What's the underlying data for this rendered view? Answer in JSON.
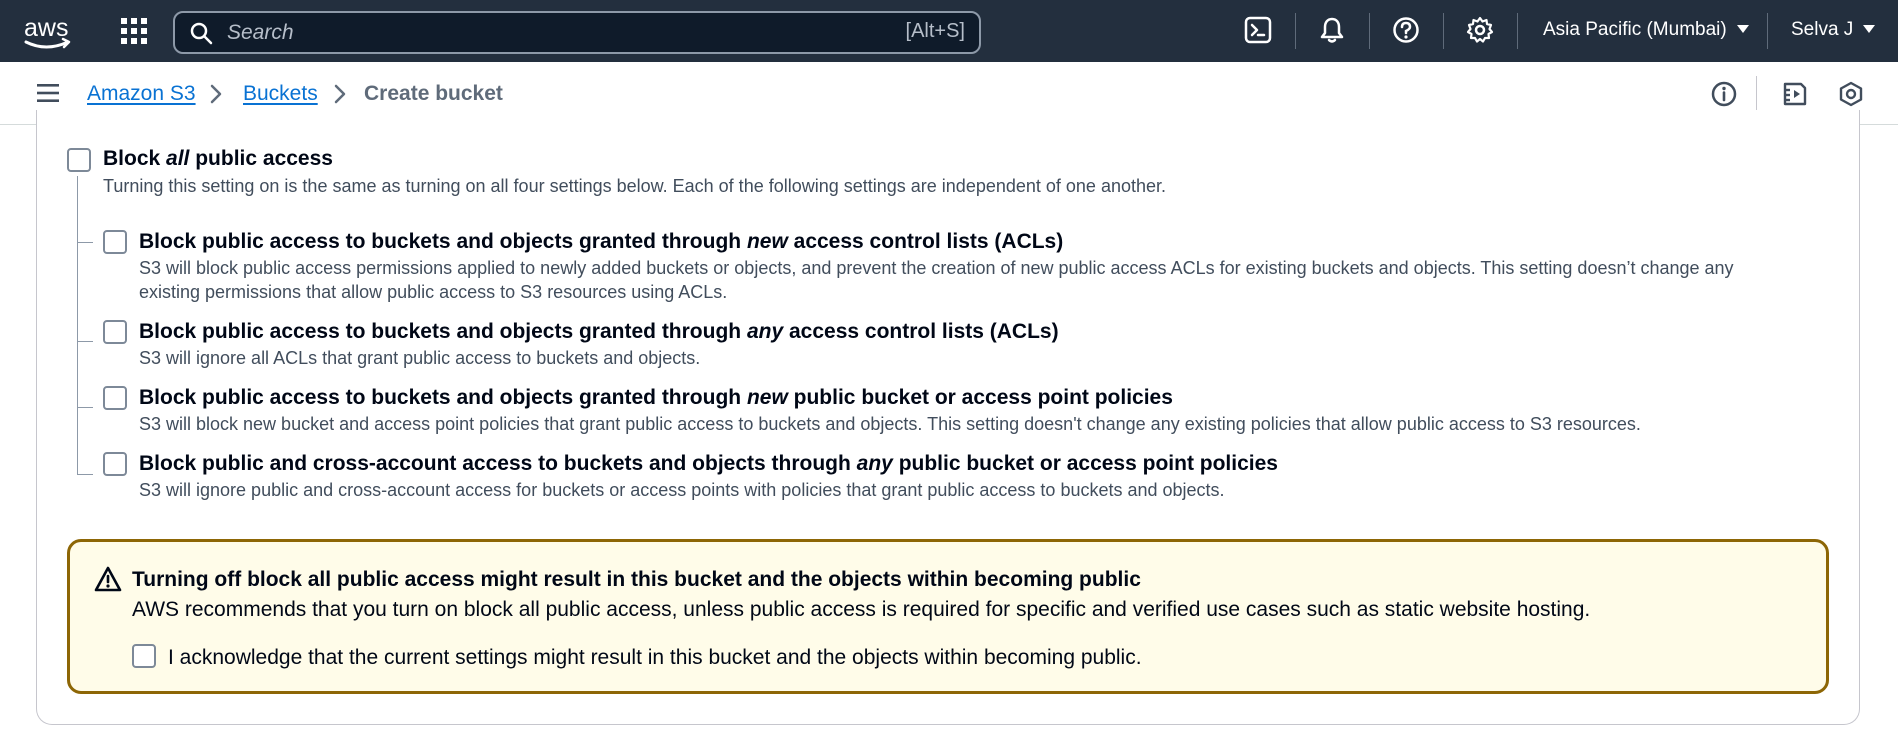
{
  "topbar": {
    "logo_text": "aws",
    "search": {
      "placeholder": "Search",
      "shortcut_hint": "[Alt+S]"
    },
    "region": "Asia Pacific (Mumbai)",
    "user": "Selva J",
    "icons": [
      "cloudshell-icon",
      "bell-icon",
      "help-icon",
      "settings-icon"
    ]
  },
  "breadcrumb": {
    "items": [
      {
        "label": "Amazon S3",
        "link": true
      },
      {
        "label": "Buckets",
        "link": true
      },
      {
        "label": "Create bucket",
        "link": false
      }
    ]
  },
  "block_public_access": {
    "main": {
      "title_pre": "Block ",
      "title_em": "all",
      "title_post": " public access",
      "checked": false,
      "description": "Turning this setting on is the same as turning on all four settings below. Each of the following settings are independent of one another."
    },
    "options": [
      {
        "title_pre": "Block public access to buckets and objects granted through ",
        "title_em": "new",
        "title_post": " access control lists (ACLs)",
        "checked": false,
        "description": "S3 will block public access permissions applied to newly added buckets or objects, and prevent the creation of new public access ACLs for existing buckets and objects. This setting doesn’t change any existing permissions that allow public access to S3 resources using ACLs."
      },
      {
        "title_pre": "Block public access to buckets and objects granted through ",
        "title_em": "any",
        "title_post": " access control lists (ACLs)",
        "checked": false,
        "description": "S3 will ignore all ACLs that grant public access to buckets and objects."
      },
      {
        "title_pre": "Block public access to buckets and objects granted through ",
        "title_em": "new",
        "title_post": " public bucket or access point policies",
        "checked": false,
        "description": "S3 will block new bucket and access point policies that grant public access to buckets and objects. This setting doesn't change any existing policies that allow public access to S3 resources."
      },
      {
        "title_pre": "Block public and cross-account access to buckets and objects through ",
        "title_em": "any",
        "title_post": " public bucket or access point policies",
        "checked": false,
        "description": "S3 will ignore public and cross-account access for buckets or access points with policies that grant public access to buckets and objects."
      }
    ]
  },
  "warning": {
    "title": "Turning off block all public access might result in this bucket and the objects within becoming public",
    "text": "AWS recommends that you turn on block all public access, unless public access is required for specific and verified use cases such as static website hosting.",
    "acknowledge_label": "I acknowledge that the current settings might result in this bucket and the objects within becoming public.",
    "acknowledged": false,
    "border_color": "#8d6605",
    "background_color": "#fffce9"
  },
  "colors": {
    "topbar_bg": "#232f3e",
    "link": "#0972d3",
    "text": "#000716",
    "secondary_text": "#414d5c"
  }
}
